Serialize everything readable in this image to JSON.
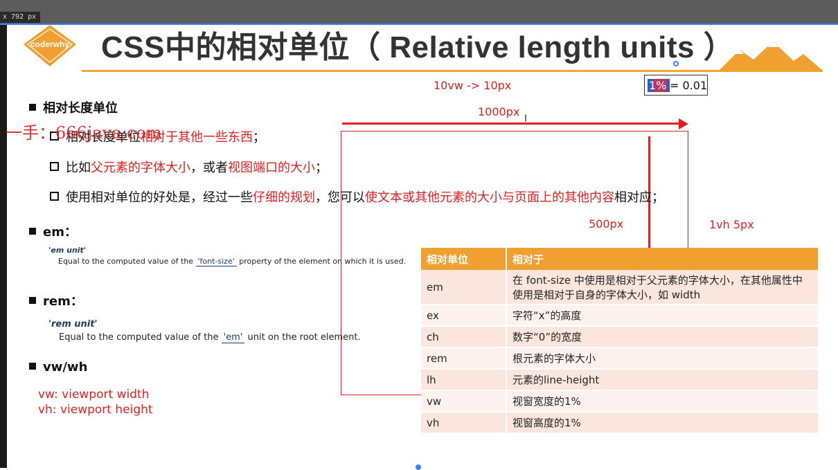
{
  "toolbar": {
    "size_badge": "x 792  px"
  },
  "header": {
    "logo_text": "coderwhy",
    "title": "CSS中的相对单位（ Relative length units ）"
  },
  "annotations": {
    "vw_px": "10vw -> 10px",
    "equation": {
      "highlight": "1%",
      "rest": "= 0.01"
    },
    "width_px": "1000px",
    "height_px": "500px",
    "vh_px": "1vh 5px",
    "watermark": "一手：666java.com"
  },
  "relative": {
    "heading": "相对长度单位",
    "line1": {
      "a": "相对长度单位",
      "b": "相对于其他一些东西",
      "c": "；"
    },
    "line2": {
      "a": "比如",
      "b": "父元素的字体大小",
      "c": "，或者",
      "d": "视图端口的大小",
      "e": "；"
    },
    "line3": {
      "a": "使用相对单位的好处是，经过一些",
      "b": "仔细的规划",
      "c": "，您可以",
      "d": "使文本或其他元素的大小与页面上的其他内容",
      "e": "相对应；"
    }
  },
  "em": {
    "heading": "em：",
    "term": "'em unit'",
    "text_before": "Equal to the computed value of the",
    "link": "'font-size'",
    "text_after": "property of the element on which it is used."
  },
  "rem": {
    "heading": "rem：",
    "term": "'rem unit'",
    "text_before": "Equal to the computed value of the",
    "link": "'em'",
    "text_after": "unit on the root element."
  },
  "vwvh": {
    "heading": "vw/wh",
    "vw": "vw: viewport width",
    "vh": "vh: viewport height"
  },
  "table": {
    "headers": [
      "相对单位",
      "相对于"
    ],
    "rows": [
      [
        "em",
        "在 font-size 中使用是相对于父元素的字体大小，在其他属性中使用是相对于自身的字体大小，如 width"
      ],
      [
        "ex",
        "字符“x”的高度"
      ],
      [
        "ch",
        "数字“0”的宽度"
      ],
      [
        "rem",
        "根元素的字体大小"
      ],
      [
        "lh",
        "元素的line-height"
      ],
      [
        "vw",
        "视窗宽度的1%"
      ],
      [
        "vh",
        "视窗高度的1%"
      ]
    ]
  },
  "colors": {
    "accent": "#f0a030",
    "annotation_red": "#e02020",
    "title": "#333333"
  }
}
